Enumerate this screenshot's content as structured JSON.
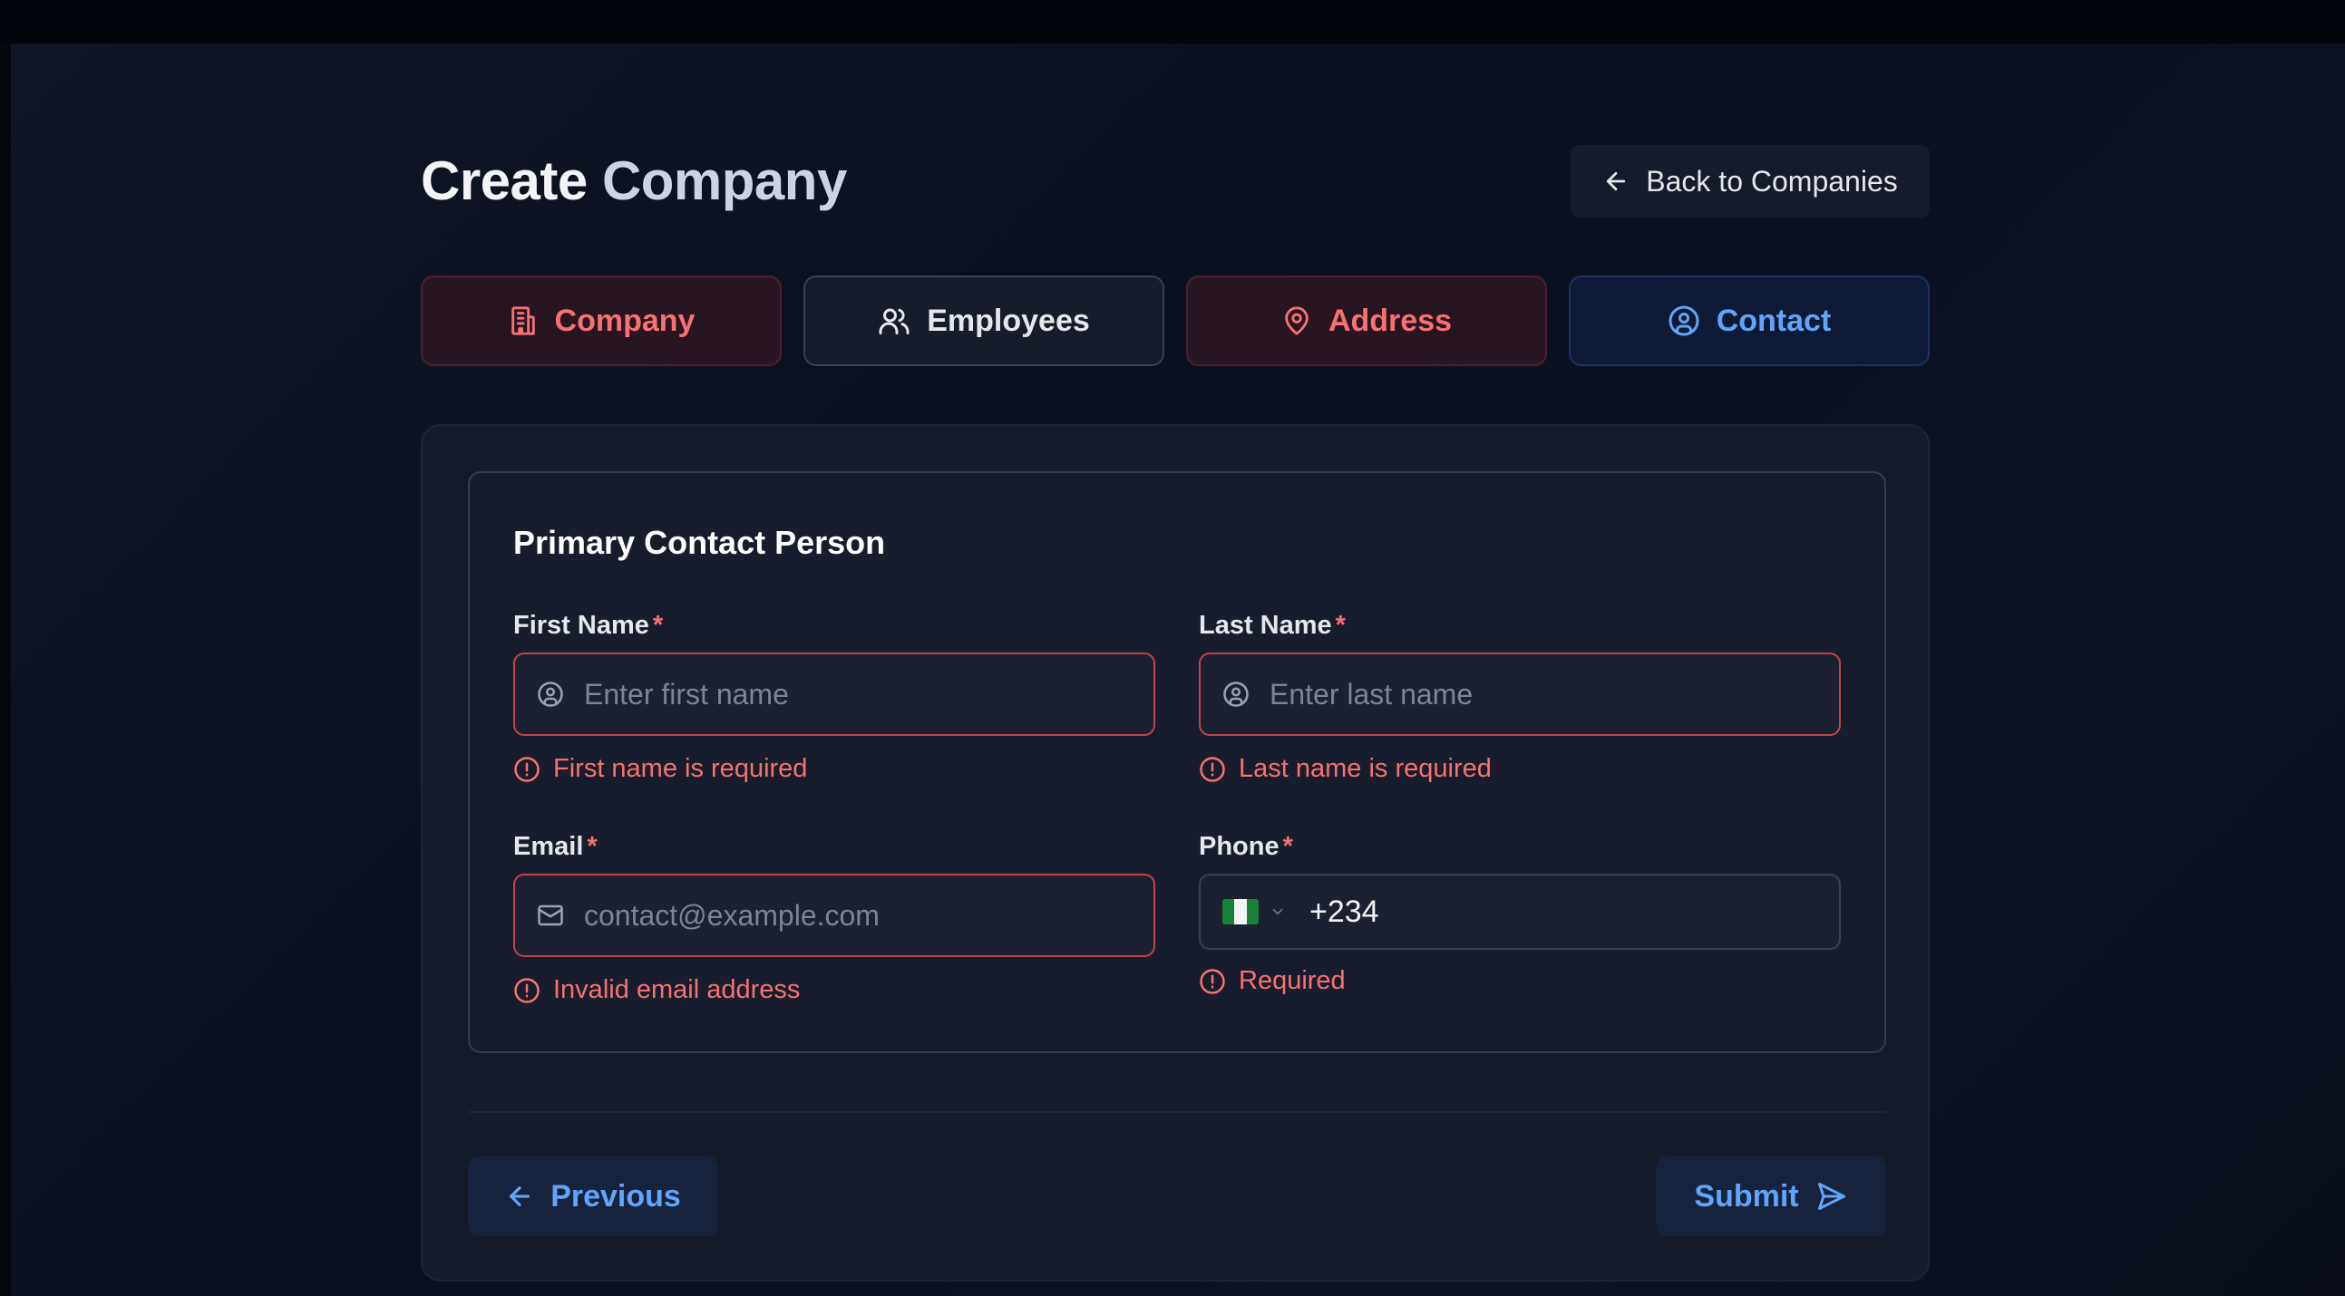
{
  "header": {
    "title_word1": "Create",
    "title_word2": "Company",
    "back_label": "Back to Companies"
  },
  "tabs": [
    {
      "label": "Company",
      "icon": "building-icon",
      "state": "error"
    },
    {
      "label": "Employees",
      "icon": "users-icon",
      "state": "neutral"
    },
    {
      "label": "Address",
      "icon": "map-pin-icon",
      "state": "error"
    },
    {
      "label": "Contact",
      "icon": "user-circle-icon",
      "state": "active"
    }
  ],
  "section": {
    "title": "Primary Contact Person"
  },
  "fields": {
    "first_name": {
      "label": "First Name",
      "required": "*",
      "placeholder": "Enter first name",
      "error": "First name is required"
    },
    "last_name": {
      "label": "Last Name",
      "required": "*",
      "placeholder": "Enter last name",
      "error": "Last name is required"
    },
    "email": {
      "label": "Email",
      "required": "*",
      "placeholder": "contact@example.com",
      "error": "Invalid email address"
    },
    "phone": {
      "label": "Phone",
      "required": "*",
      "value": "+234",
      "country": "Nigeria flag",
      "error": "Required"
    }
  },
  "actions": {
    "previous_label": "Previous",
    "submit_label": "Submit"
  },
  "colors": {
    "error": "#f87171",
    "accent": "#60a5fa",
    "background": "#0a0f1d"
  }
}
